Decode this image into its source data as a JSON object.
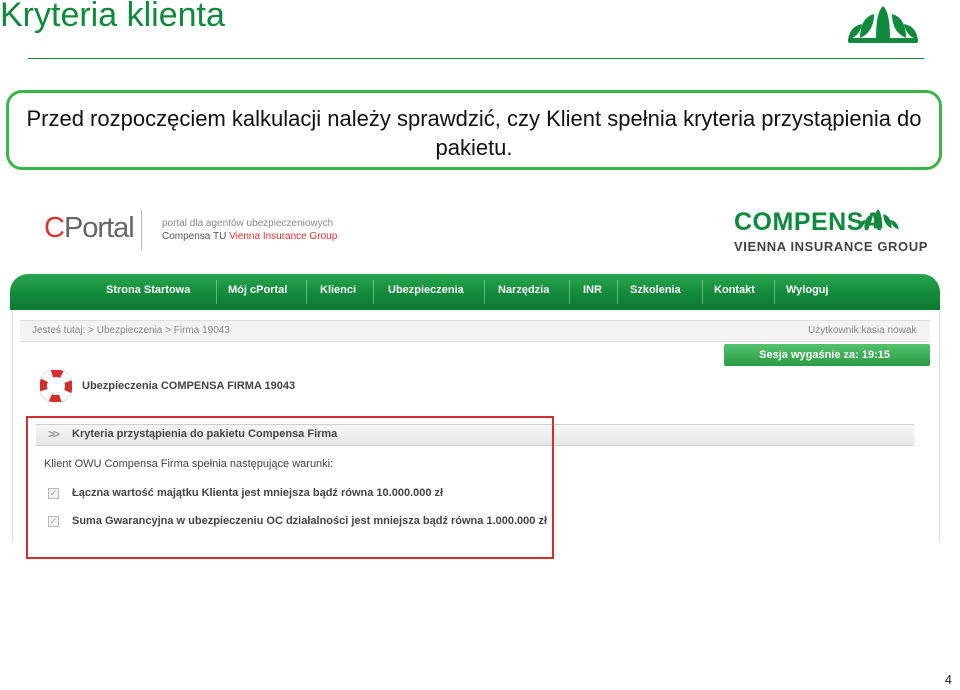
{
  "slide": {
    "title": "Kryteria klienta",
    "callout": "Przed rozpoczęciem kalkulacji należy sprawdzić, czy Klient spełnia kryteria przystąpienia do pakietu.",
    "page_number": "4"
  },
  "portal": {
    "logo_c": "C",
    "logo_rest": "Portal",
    "tagline_line1": "portal dla agentów ubezpieczeniowych",
    "tagline_brand": "Compensa TU ",
    "tagline_group": "Vienna Insurance Group",
    "compensa_word": "COMPENSA",
    "vig_word": "VIENNA INSURANCE GROUP",
    "nav": [
      "Strona Startowa",
      "Mój cPortal",
      "Klienci",
      "Ubezpieczenia",
      "Narzędzia",
      "INR",
      "Szkolenia",
      "Kontakt",
      "Wyloguj"
    ],
    "breadcrumb": "Jesteś tutaj:  > Ubezpieczenia > Firma 19043",
    "user": "Użytkownik:kasia nowak",
    "session": "Sesja wygaśnie za: 19:15",
    "insurance_title": "Ubezpieczenia COMPENSA FIRMA 19043",
    "section_title": "Kryteria przystąpienia do pakietu Compensa Firma",
    "conditions_intro": "Klient OWU Compensa Firma spełnia następujące warunki:",
    "conditions": [
      {
        "text": "Łączna wartość majątku Klienta jest mniejsza bądź równa 10.000.000 zł",
        "checked": true
      },
      {
        "text": "Suma Gwarancyjna w ubezpieczeniu OC działalności jest mniejsza bądź równa 1.000.000 zł",
        "checked": true
      }
    ]
  },
  "colors": {
    "brand_green": "#0f8a3c",
    "callout_border": "#39b54a",
    "highlight_red": "#d32f2f"
  }
}
